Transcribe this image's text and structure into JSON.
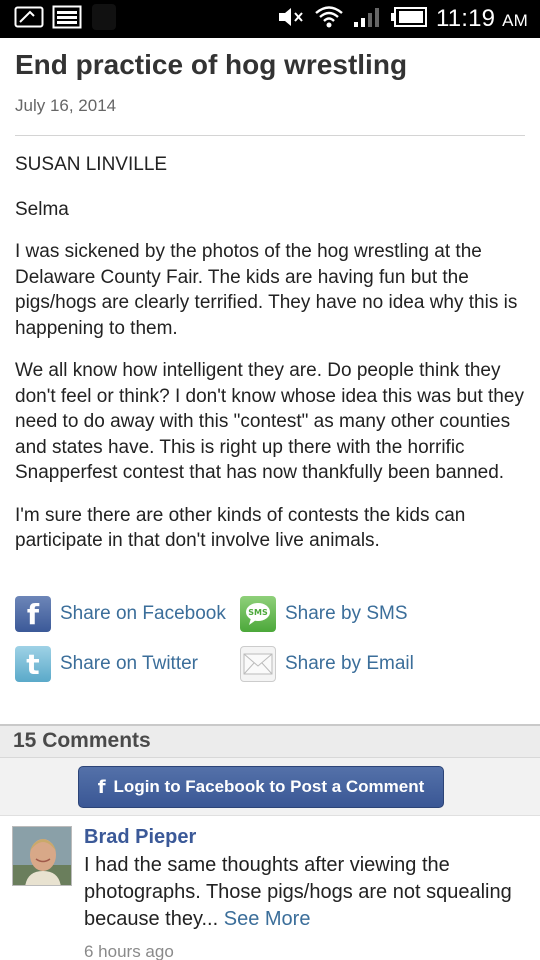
{
  "status_bar": {
    "time": "11:19",
    "ampm": "AM"
  },
  "article": {
    "title": "End practice of hog wrestling",
    "date": "July 16, 2014",
    "author": "SUSAN LINVILLE",
    "city": "Selma",
    "paragraphs": [
      "I was sickened by the photos of the hog wrestling at the Delaware County Fair. The kids are having fun but the pigs/hogs are clearly terrified. They have no idea why this is happening to them.",
      "We all know how intelligent they are. Do people think they don't feel or think? I don't know whose idea this was but they need to do away with this \"contest\" as many other counties and states have. This is right up there with the horrific Snapperfest contest that has now thankfully been banned.",
      "I'm sure there are other kinds of contests the kids can participate in that don't involve live animals."
    ]
  },
  "share": {
    "facebook": {
      "label": "Share on Facebook",
      "icon": "facebook-icon",
      "glyph": "f"
    },
    "sms": {
      "label": "Share by SMS",
      "icon": "sms-icon",
      "glyph": "SMS"
    },
    "twitter": {
      "label": "Share on Twitter",
      "icon": "twitter-icon",
      "glyph": "t"
    },
    "email": {
      "label": "Share by Email",
      "icon": "email-icon"
    }
  },
  "comments": {
    "count_label": "15 Comments",
    "login_button": {
      "glyph": "f",
      "label": "Login to Facebook to Post a Comment"
    },
    "items": [
      {
        "author": "Brad Pieper",
        "text": "I had the same thoughts after viewing the photographs. Those pigs/hogs are not squealing because they...",
        "see_more": "See More",
        "time": "6 hours ago"
      }
    ]
  },
  "colors": {
    "link": "#3b6e9a",
    "facebook": "#3b5998",
    "status_bar": "#000000"
  }
}
